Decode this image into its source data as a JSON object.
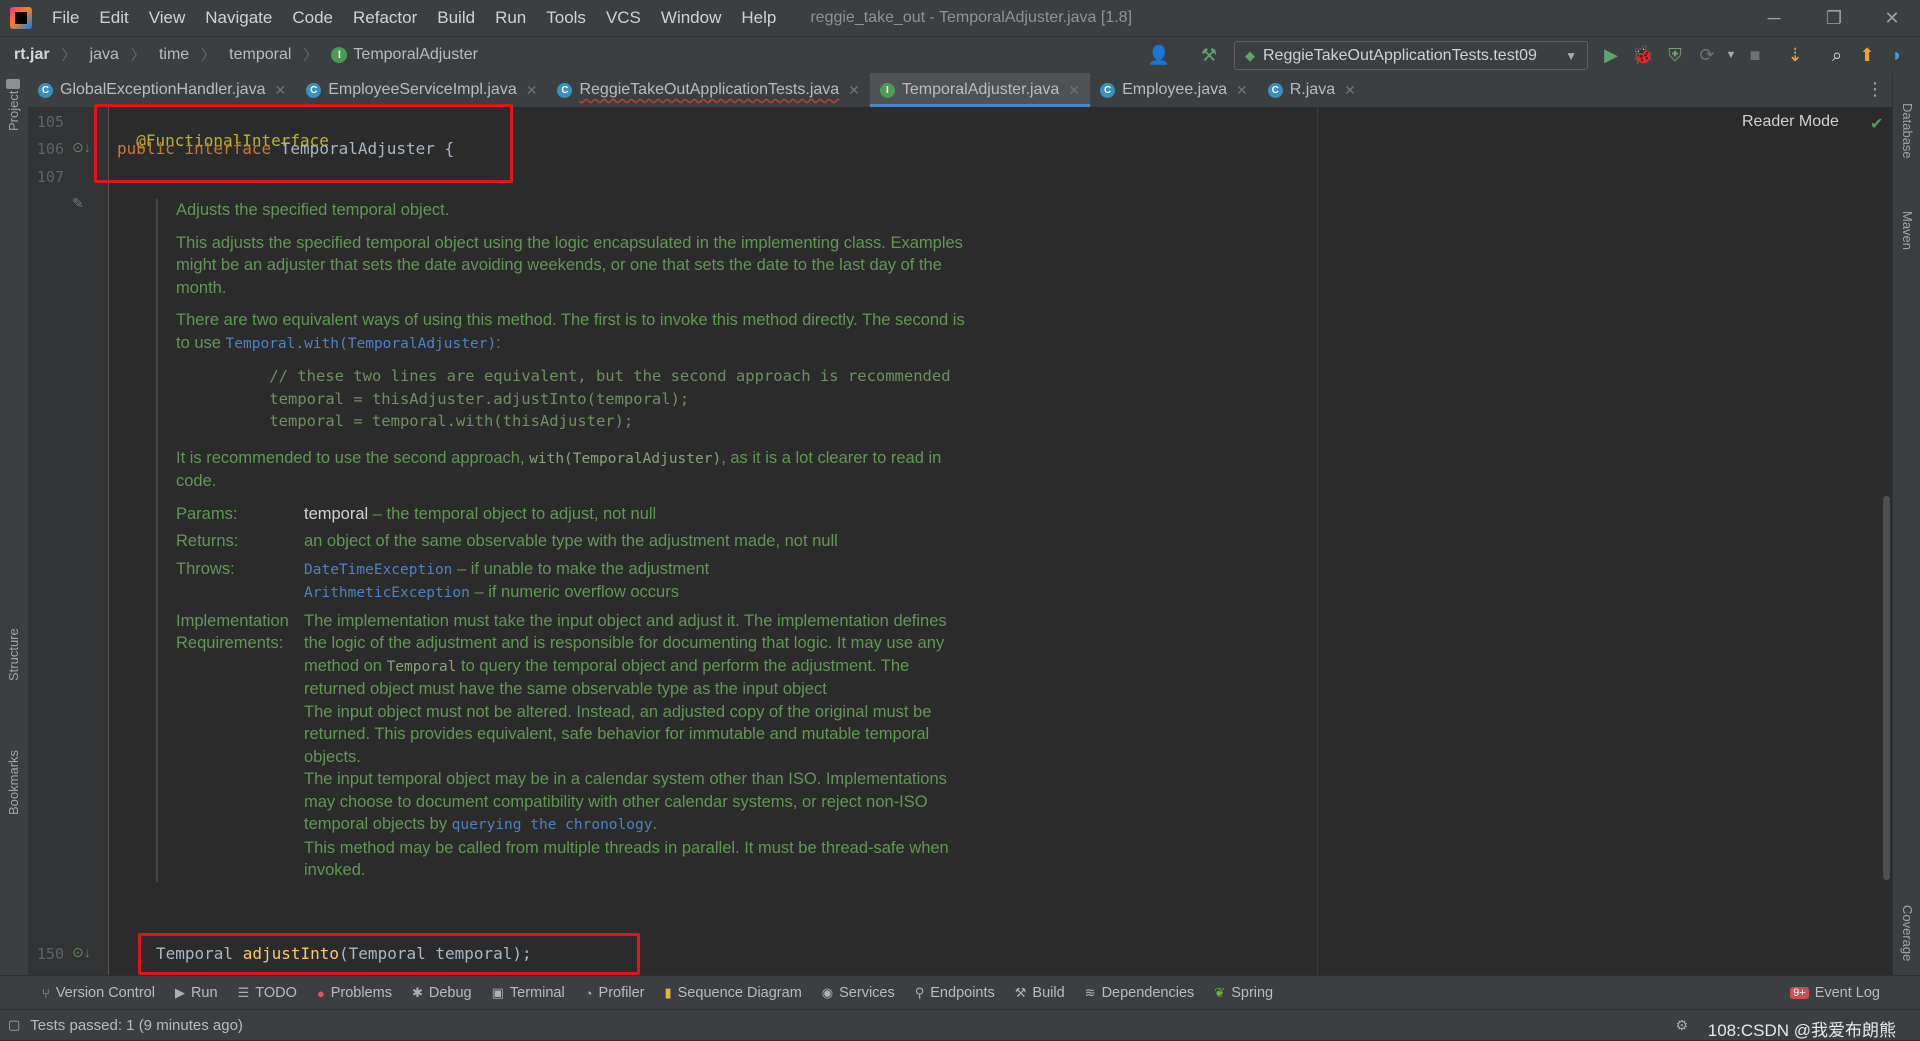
{
  "menubar": {
    "items": [
      "File",
      "Edit",
      "View",
      "Navigate",
      "Code",
      "Refactor",
      "Build",
      "Run",
      "Tools",
      "VCS",
      "Window",
      "Help"
    ],
    "window_title": "reggie_take_out - TemporalAdjuster.java [1.8]"
  },
  "breadcrumb": {
    "items": [
      "rt.jar",
      "java",
      "time",
      "temporal",
      "TemporalAdjuster"
    ]
  },
  "run_config": {
    "label": "ReggieTakeOutApplicationTests.test09"
  },
  "tabs": [
    {
      "label": "GlobalExceptionHandler.java"
    },
    {
      "label": "EmployeeServiceImpl.java"
    },
    {
      "label": "ReggieTakeOutApplicationTests.java"
    },
    {
      "label": "TemporalAdjuster.java"
    },
    {
      "label": "Employee.java"
    },
    {
      "label": "R.java"
    }
  ],
  "side_labels": {
    "left_top": "Project",
    "left_structure": "Structure",
    "left_bookmarks": "Bookmarks",
    "right_database": "Database",
    "right_maven": "Maven",
    "right_coverage": "Coverage"
  },
  "editor": {
    "line_numbers": [
      "105",
      "106",
      "107",
      "150"
    ],
    "annotation": "@FunctionalInterface",
    "decl_keyword1": "public",
    "decl_keyword2": "interface",
    "decl_name": "TemporalAdjuster {",
    "method_type": "Temporal",
    "method_name": "adjustInto",
    "method_params": "(Temporal temporal);",
    "reader_mode": "Reader Mode"
  },
  "doc": {
    "summary": "Adjusts the specified temporal object.",
    "p1": "This adjusts the specified temporal object using the logic encapsulated in the implementing class. Examples might be an adjuster that sets the date avoiding weekends, or one that sets the date to the last day of the month.",
    "p2_text": "There are two equivalent ways of using this method. The first is to invoke this method directly. The second is to use",
    "p2_link": "Temporal.with(TemporalAdjuster)",
    "p2_end": ":",
    "code_block": "          // these two lines are equivalent, but the second approach is recommended\n          temporal = thisAdjuster.adjustInto(temporal);\n          temporal = temporal.with(thisAdjuster);",
    "p3_a": "It is recommended to use the second approach,",
    "p3_code": "with(TemporalAdjuster)",
    "p3_b": ", as it is a lot clearer to read in code.",
    "params_label": "Params:",
    "params_name": "temporal",
    "params_desc": " – the temporal object to adjust, not null",
    "returns_label": "Returns:",
    "returns_desc": "an object of the same observable type with the adjustment made, not null",
    "throws_label": "Throws:",
    "throws1_link": "DateTimeException",
    "throws1_desc": " – if unable to make the adjustment",
    "throws2_link": "ArithmeticException",
    "throws2_desc": " – if numeric overflow occurs",
    "impl_label": "Implementation Requirements:",
    "impl_1a": "The implementation must take the input object and adjust it. The implementation defines the logic of the adjustment and is responsible for documenting that logic. It may use any method on",
    "impl_1code": "Temporal",
    "impl_1b": "to query the temporal object and perform the adjustment. The returned object must have the same observable type as the input object",
    "impl_2": "The input object must not be altered. Instead, an adjusted copy of the original must be returned. This provides equivalent, safe behavior for immutable and mutable temporal objects.",
    "impl_3a": "The input temporal object may be in a calendar system other than ISO. Implementations may choose to document compatibility with other calendar systems, or reject non-ISO temporal objects by",
    "impl_3link": "querying the chronology",
    "impl_3b": ".",
    "impl_4": "This method may be called from multiple threads in parallel. It must be thread-safe when invoked."
  },
  "bottom_tools": [
    "Version Control",
    "Run",
    "TODO",
    "Problems",
    "Debug",
    "Terminal",
    "Profiler",
    "Sequence Diagram",
    "Services",
    "Endpoints",
    "Build",
    "Dependencies",
    "Spring"
  ],
  "event_log": {
    "badge": "9+",
    "label": "Event Log"
  },
  "status": {
    "text": "Tests passed: 1 (9 minutes ago)",
    "right": "108:CSDN @我爱布朗熊"
  },
  "colors": {
    "highlight_box": "#e0141b",
    "accent": "#4a88c7",
    "doc_green": "#629755"
  }
}
